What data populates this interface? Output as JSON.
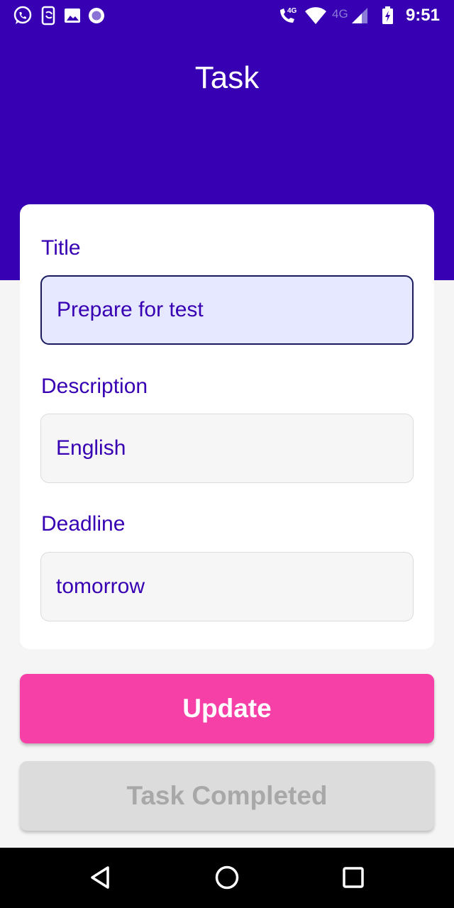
{
  "status_bar": {
    "time": "9:51",
    "left_icons": [
      "whatsapp-icon",
      "phone-sync-icon",
      "image-icon",
      "record-icon"
    ],
    "right_icons": [
      "call-4g-icon",
      "wifi-icon",
      "signal-4g-icon",
      "battery-icon"
    ],
    "volte_text": "4G",
    "network_text": "4G"
  },
  "app_bar": {
    "title": "Task"
  },
  "form": {
    "title": {
      "label": "Title",
      "value": "Prepare for test"
    },
    "description": {
      "label": "Description",
      "value": "English"
    },
    "deadline": {
      "label": "Deadline",
      "value": "tomorrow"
    }
  },
  "buttons": {
    "update": "Update",
    "task_completed": "Task Completed"
  },
  "colors": {
    "primary": "#3700b3",
    "accent": "#f73fa8",
    "disabled": "#dcdcdc"
  },
  "nav_bar": {
    "icons": [
      "back-icon",
      "home-icon",
      "recents-icon"
    ]
  }
}
